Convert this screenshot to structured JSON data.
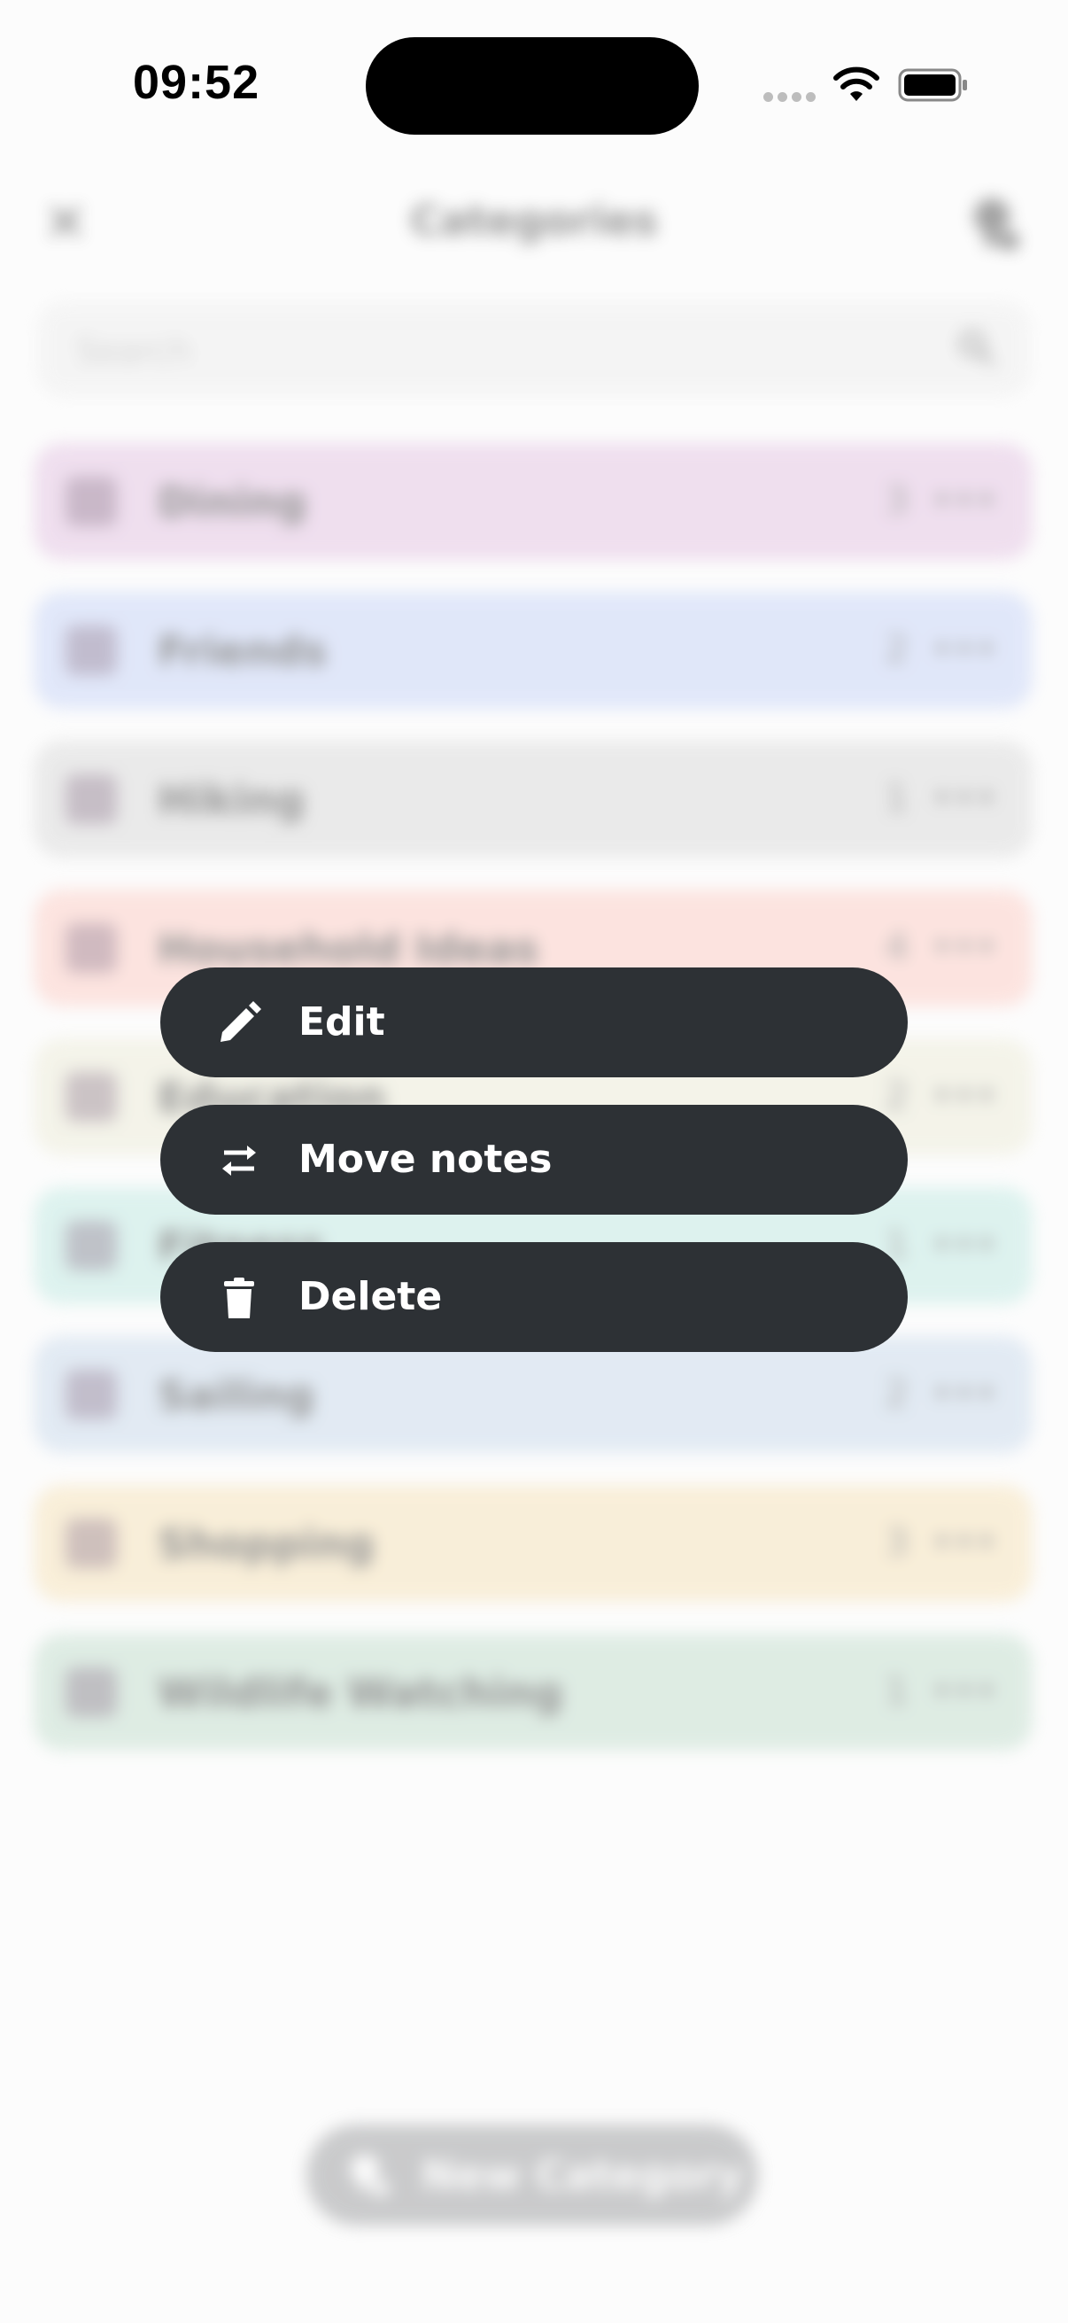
{
  "status_bar": {
    "time": "09:52"
  },
  "header": {
    "title": "Categories"
  },
  "search": {
    "placeholder": "Search"
  },
  "categories": [
    {
      "label": "Dining",
      "count": "3",
      "color": "#e7cce6"
    },
    {
      "label": "Friends",
      "count": "2",
      "color": "#cfdaf8"
    },
    {
      "label": "Hiking",
      "count": "1",
      "color": "#dfdfdf"
    },
    {
      "label": "Household Ideas",
      "count": "4",
      "color": "#fdd4cd"
    },
    {
      "label": "Education",
      "count": "2",
      "color": "#efeedd"
    },
    {
      "label": "Fitness",
      "count": "1",
      "color": "#c9ece6"
    },
    {
      "label": "Sailing",
      "count": "2",
      "color": "#d1dfee"
    },
    {
      "label": "Shopping",
      "count": "3",
      "color": "#f7e6c2"
    },
    {
      "label": "Wildlife Watching",
      "count": "1",
      "color": "#cbe2d4"
    }
  ],
  "fab": {
    "label": "New Category"
  },
  "context_menu": {
    "items": [
      {
        "label": "Edit",
        "icon": "pencil-icon"
      },
      {
        "label": "Move notes",
        "icon": "swap-arrows-icon"
      },
      {
        "label": "Delete",
        "icon": "trash-icon"
      }
    ],
    "background": "#2d3135"
  }
}
